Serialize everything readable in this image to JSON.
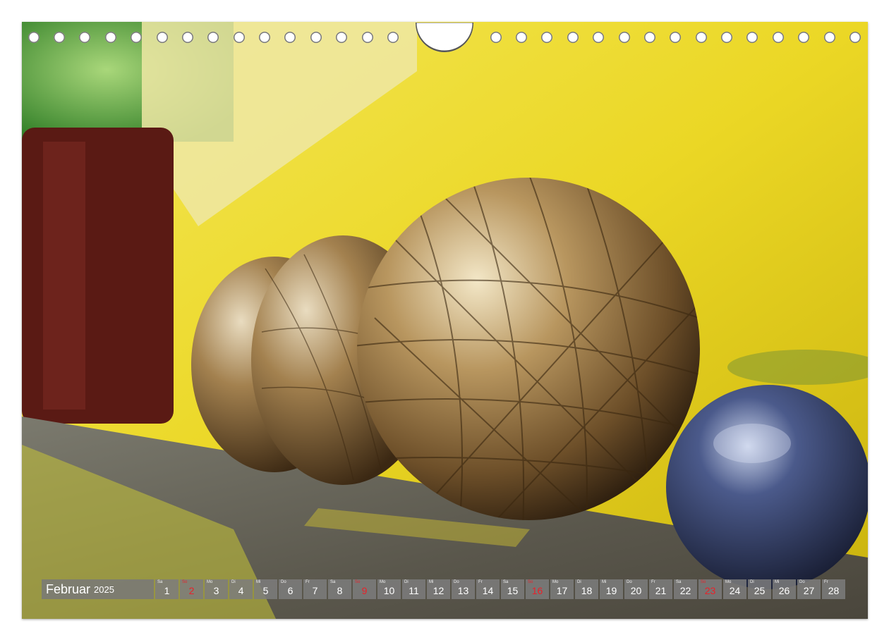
{
  "calendar": {
    "month": "Februar",
    "year": "2025",
    "days": [
      {
        "num": "1",
        "wd": "Sa",
        "red": false
      },
      {
        "num": "2",
        "wd": "So",
        "red": true
      },
      {
        "num": "3",
        "wd": "Mo",
        "red": false
      },
      {
        "num": "4",
        "wd": "Di",
        "red": false
      },
      {
        "num": "5",
        "wd": "Mi",
        "red": false
      },
      {
        "num": "6",
        "wd": "Do",
        "red": false
      },
      {
        "num": "7",
        "wd": "Fr",
        "red": false
      },
      {
        "num": "8",
        "wd": "Sa",
        "red": false
      },
      {
        "num": "9",
        "wd": "So",
        "red": true
      },
      {
        "num": "10",
        "wd": "Mo",
        "red": false
      },
      {
        "num": "11",
        "wd": "Di",
        "red": false
      },
      {
        "num": "12",
        "wd": "Mi",
        "red": false
      },
      {
        "num": "13",
        "wd": "Do",
        "red": false
      },
      {
        "num": "14",
        "wd": "Fr",
        "red": false
      },
      {
        "num": "15",
        "wd": "Sa",
        "red": false
      },
      {
        "num": "16",
        "wd": "So",
        "red": true
      },
      {
        "num": "17",
        "wd": "Mo",
        "red": false
      },
      {
        "num": "18",
        "wd": "Di",
        "red": false
      },
      {
        "num": "19",
        "wd": "Mi",
        "red": false
      },
      {
        "num": "20",
        "wd": "Do",
        "red": false
      },
      {
        "num": "21",
        "wd": "Fr",
        "red": false
      },
      {
        "num": "22",
        "wd": "Sa",
        "red": false
      },
      {
        "num": "23",
        "wd": "So",
        "red": true
      },
      {
        "num": "24",
        "wd": "Mo",
        "red": false
      },
      {
        "num": "25",
        "wd": "Di",
        "red": false
      },
      {
        "num": "26",
        "wd": "Mi",
        "red": false
      },
      {
        "num": "27",
        "wd": "Do",
        "red": false
      },
      {
        "num": "28",
        "wd": "Fr",
        "red": false
      }
    ]
  },
  "colors": {
    "sunday": "#e8222a",
    "wall": "#e8d51f",
    "bronze": "#a8835a",
    "steel": "#2c3560"
  },
  "photo": {
    "icon": "petanque-balls-photo"
  }
}
